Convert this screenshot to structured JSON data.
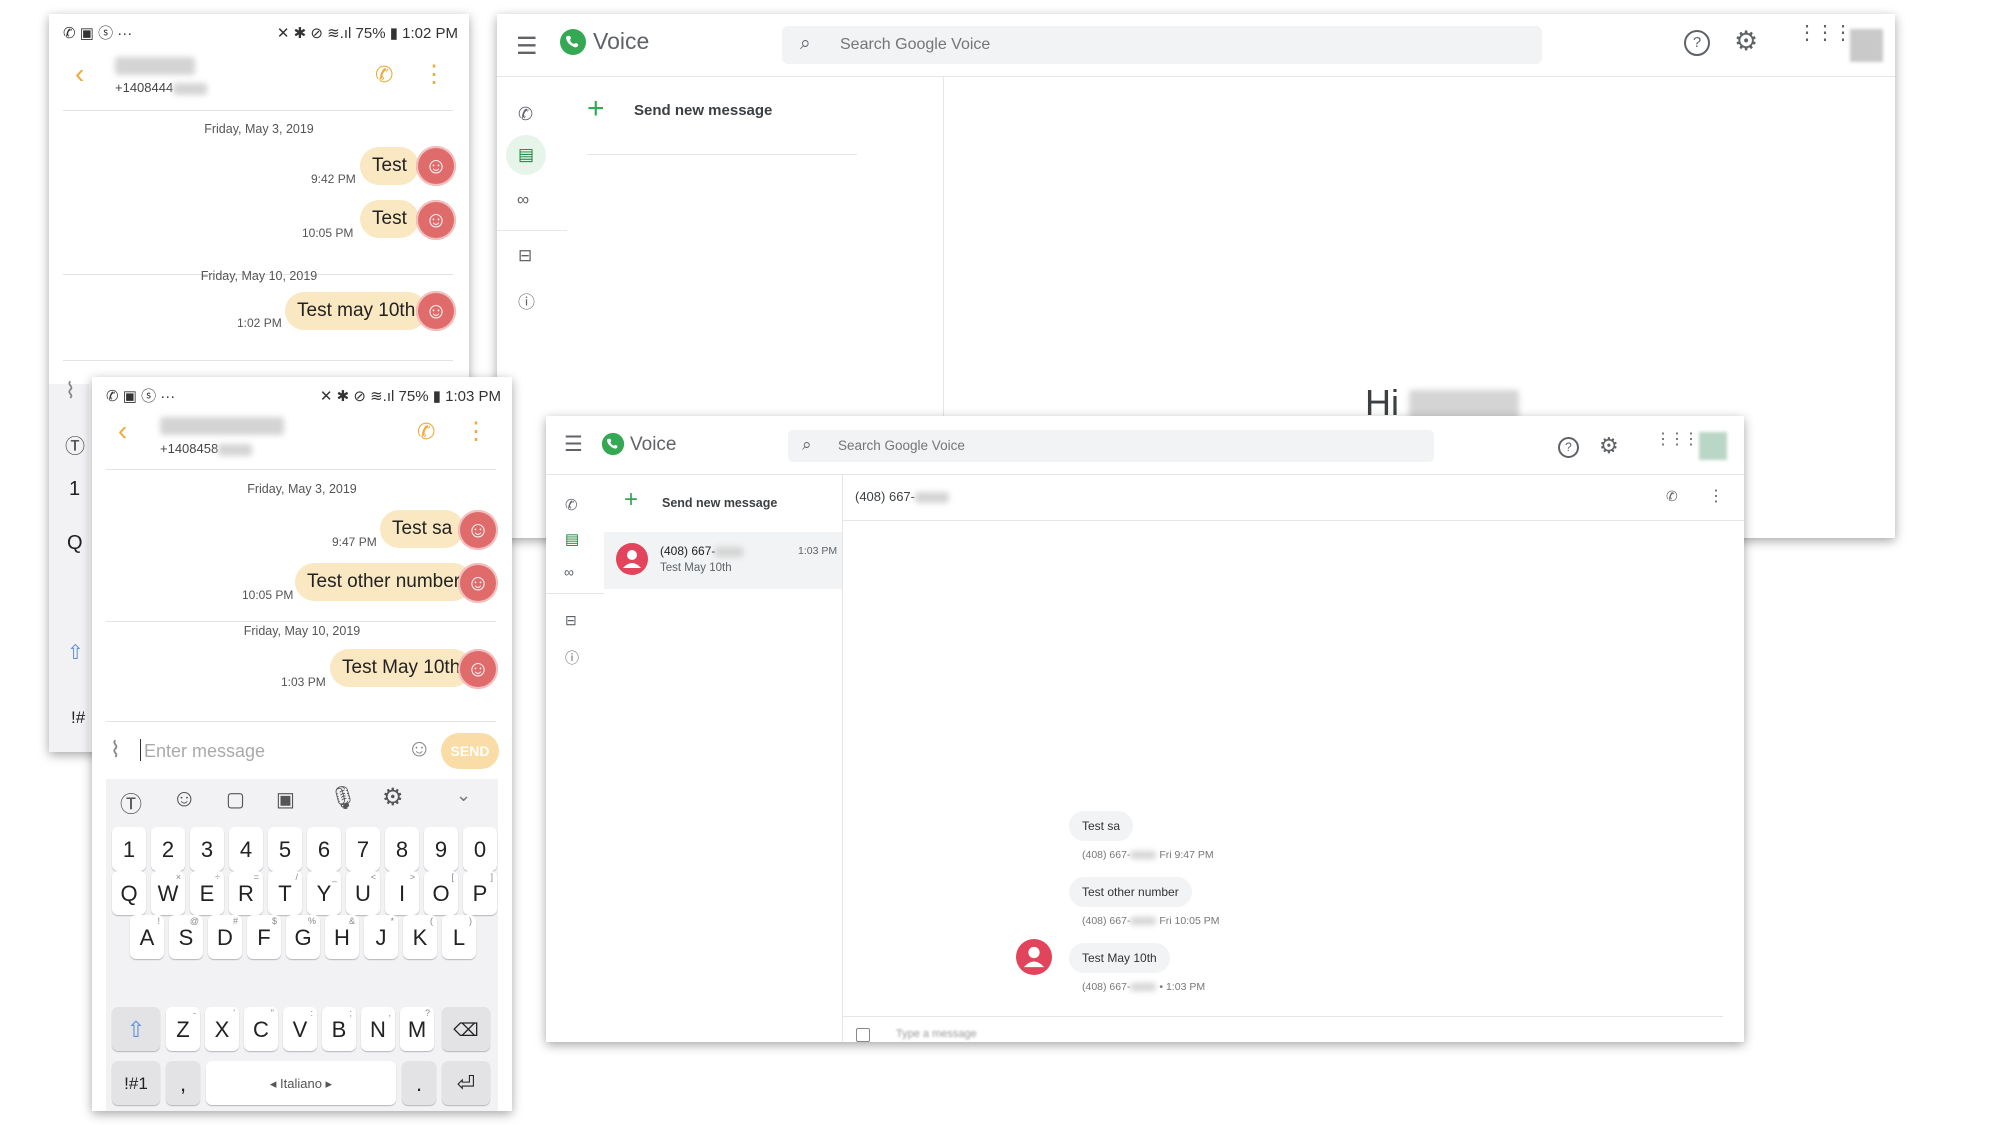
{
  "phone1": {
    "status_time": "75% ▮ 1:02 PM",
    "contact_number": "+1408444",
    "date1": "Friday, May 3, 2019",
    "msg1_time": "9:42 PM",
    "msg1_text": "Test",
    "msg2_time": "10:05 PM",
    "msg2_text": "Test",
    "date2": "Friday, May 10, 2019",
    "msg3_time": "1:02 PM",
    "msg3_text": "Test may 10th",
    "kb_keys": [
      "1",
      "Q",
      "!#"
    ]
  },
  "phone2": {
    "status_time": "75% ▮ 1:03 PM",
    "contact_number": "+1408458",
    "date1": "Friday, May 3, 2019",
    "msg1_time": "9:47 PM",
    "msg1_text": "Test sa",
    "msg2_time": "10:05 PM",
    "msg2_text": "Test other number",
    "date2": "Friday, May 10, 2019",
    "msg3_time": "1:03 PM",
    "msg3_text": "Test May 10th",
    "input_placeholder": "Enter message",
    "send_label": "SEND",
    "keyboard": {
      "row_numbers": [
        "1",
        "2",
        "3",
        "4",
        "5",
        "6",
        "7",
        "8",
        "9",
        "0"
      ],
      "row_q": [
        "Q",
        "W",
        "E",
        "R",
        "T",
        "Y",
        "U",
        "I",
        "O",
        "P"
      ],
      "row_q_sup": [
        "",
        "×",
        "÷",
        "=",
        "/",
        "_",
        "<",
        ">",
        "[",
        "]"
      ],
      "row_a": [
        "A",
        "S",
        "D",
        "F",
        "G",
        "H",
        "J",
        "K",
        "L"
      ],
      "row_a_sup": [
        "!",
        "@",
        "#",
        "$",
        "%",
        "&",
        "*",
        "(",
        ")"
      ],
      "row_z": [
        "Z",
        "X",
        "C",
        "V",
        "B",
        "N",
        "M"
      ],
      "row_z_sup": [
        "-",
        "'",
        "\"",
        ":",
        ";",
        ",",
        "?"
      ],
      "symbols_label": "!#1",
      "comma": ",",
      "space_label": "◂ Italiano ▸",
      "period": "."
    }
  },
  "gv_back": {
    "brand": "Voice",
    "search_placeholder": "Search Google Voice",
    "send_new_message": "Send new message",
    "greeting": "Hi"
  },
  "gv_front": {
    "brand": "Voice",
    "search_placeholder": "Search Google Voice",
    "send_new_message": "Send new message",
    "thread_number": "(408) 667-",
    "thread_time": "1:03 PM",
    "thread_preview": "Test May 10th",
    "header_number": "(408) 667-",
    "messages": [
      {
        "text": "Test sa",
        "meta_prefix": "(408) 667-",
        "meta_suffix": "Fri 9:47 PM"
      },
      {
        "text": "Test other number",
        "meta_prefix": "(408) 667-",
        "meta_suffix": "Fri 10:05 PM"
      },
      {
        "text": "Test May 10th",
        "meta_prefix": "(408) 667-",
        "meta_suffix": "• 1:03 PM"
      }
    ],
    "compose_placeholder": "Type a message"
  },
  "colors": {
    "phone_accent": "#f0a93a",
    "bubble": "#f9e8c2",
    "gv_green": "#34a853",
    "avatar_pink": "#e2445c"
  }
}
